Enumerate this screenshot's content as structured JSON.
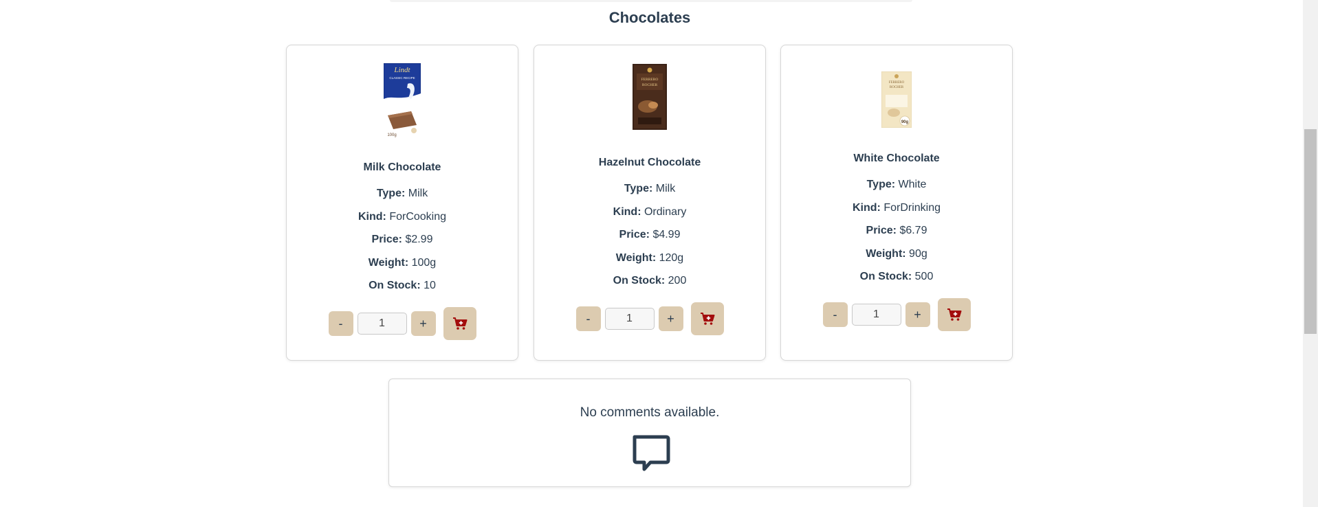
{
  "section": {
    "title": "Chocolates"
  },
  "labels": {
    "type": "Type:",
    "kind": "Kind:",
    "price": "Price:",
    "weight": "Weight:",
    "stock": "On Stock:",
    "minus": "-",
    "plus": "+"
  },
  "products": [
    {
      "name": "Milk Chocolate",
      "type": "Milk",
      "kind": "ForCooking",
      "price": "$2.99",
      "weight": "100g",
      "stock": "10",
      "quantity": "1",
      "image_brand": "Lindt",
      "image_subtitle": "CLASSIC RECIPE",
      "image_weight": "100g"
    },
    {
      "name": "Hazelnut Chocolate",
      "type": "Milk",
      "kind": "Ordinary",
      "price": "$4.99",
      "weight": "120g",
      "stock": "200",
      "quantity": "1",
      "image_brand": "FERRERO ROCHER"
    },
    {
      "name": "White Chocolate",
      "type": "White",
      "kind": "ForDrinking",
      "price": "$6.79",
      "weight": "90g",
      "stock": "500",
      "quantity": "1",
      "image_brand": "FERRERO ROCHER",
      "image_weight": "90g"
    }
  ],
  "comments": {
    "empty_text": "No comments available."
  },
  "icons": {
    "cart": "cart-plus-icon",
    "comment": "speech-bubble-icon"
  },
  "colors": {
    "button_bg": "#dccbb0",
    "cart_icon": "#a30d0d",
    "text": "#2c3e50"
  }
}
